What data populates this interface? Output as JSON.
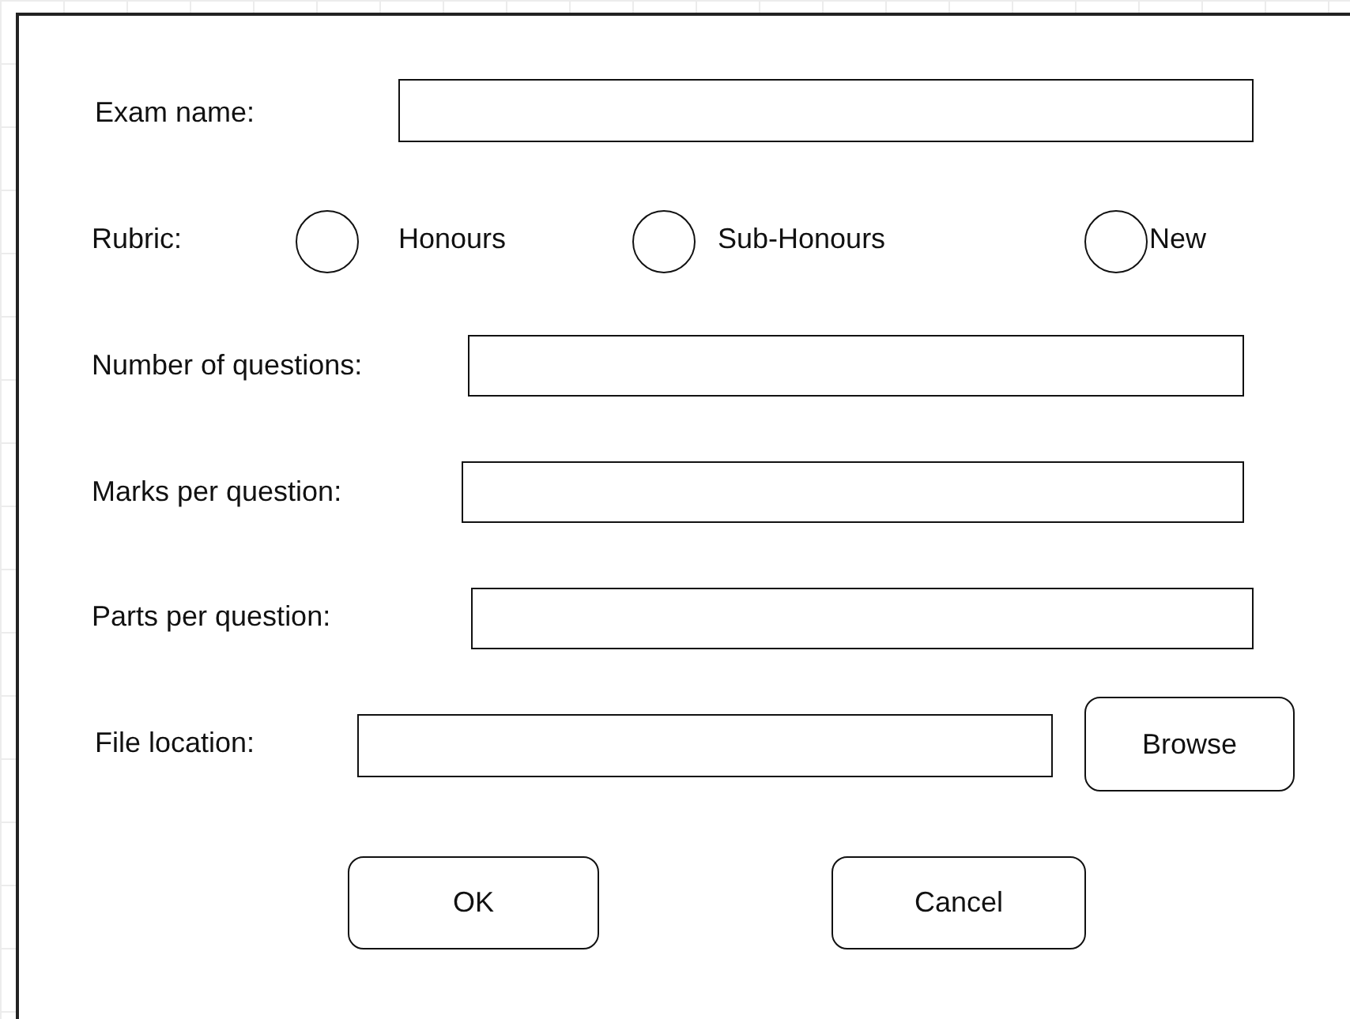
{
  "exam_name": {
    "label": "Exam name:"
  },
  "rubric": {
    "label": "Rubric:",
    "options": [
      {
        "label": "Honours",
        "selected": false
      },
      {
        "label": "Sub-Honours",
        "selected": false
      },
      {
        "label": "New",
        "selected": false
      }
    ]
  },
  "fields": [
    {
      "label": "Number of questions:"
    },
    {
      "label": "Marks per question:"
    },
    {
      "label": "Parts per question:"
    }
  ],
  "file_location": {
    "label": "File location:",
    "button": "Browse"
  },
  "buttons": [
    "OK",
    "Cancel"
  ]
}
